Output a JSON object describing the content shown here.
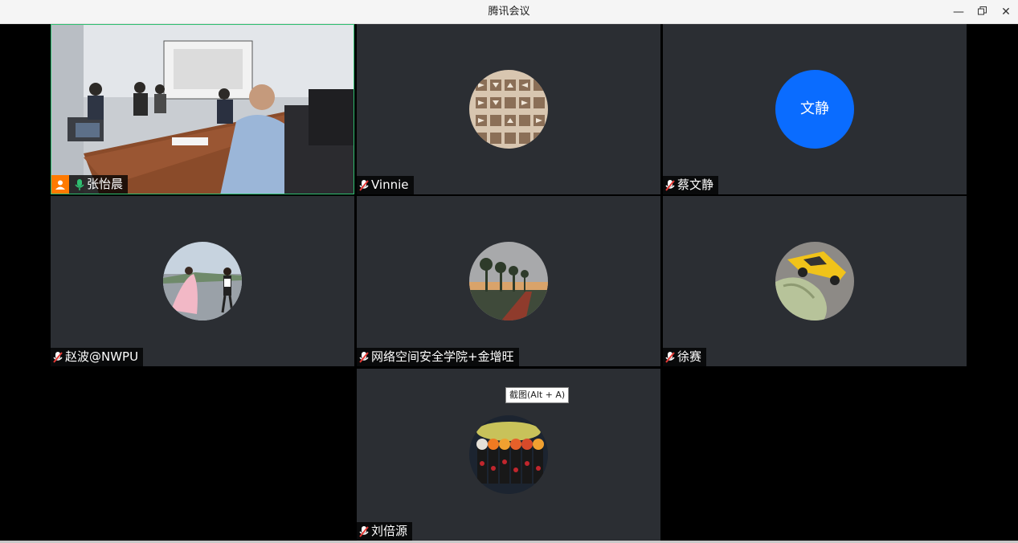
{
  "window": {
    "title": "腾讯会议",
    "min_icon": "minimize-icon",
    "restore_icon": "restore-icon",
    "close_icon": "close-icon"
  },
  "accent": {
    "host_badge": "#ff7a00",
    "mic_active": "#2fbf71",
    "mic_muted": "#e53935",
    "avatar_text_bg": "#0a6cff"
  },
  "participants": [
    {
      "name": "张怡晨",
      "is_host": true,
      "mic": "on",
      "video": "camera"
    },
    {
      "name": "Vinnie",
      "mic": "muted",
      "avatar": "image"
    },
    {
      "name": "蔡文静",
      "mic": "muted",
      "avatar_text": "文静"
    },
    {
      "name": "赵波@NWPU",
      "mic": "muted",
      "avatar": "image"
    },
    {
      "name": "网络空间安全学院+金增旺",
      "mic": "muted",
      "avatar": "image"
    },
    {
      "name": "徐赛",
      "mic": "muted",
      "avatar": "image"
    },
    {
      "name": "刘倍源",
      "mic": "muted",
      "avatar": "image"
    }
  ],
  "tooltip": {
    "text": "截图(Alt + A)"
  }
}
